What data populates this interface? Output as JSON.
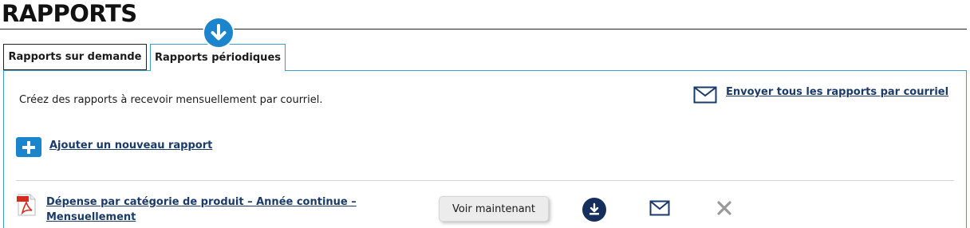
{
  "page": {
    "title": "RAPPORTS"
  },
  "tabs": [
    {
      "label": "Rapports sur demande",
      "active": false
    },
    {
      "label": "Rapports périodiques",
      "active": true
    }
  ],
  "panel": {
    "intro_text": "Créez des rapports à recevoir mensuellement par courriel.",
    "send_all_label": "Envoyer tous les rapports par courriel",
    "add_report_label": "Ajouter un nouveau rapport"
  },
  "reports": [
    {
      "name": "Dépense par catégorie de produit – Année continue – Mensuellement",
      "file_icon": "pdf-icon",
      "view_label": "Voir maintenant",
      "actions": [
        "download-icon",
        "mail-icon",
        "delete-icon"
      ]
    }
  ],
  "colors": {
    "accent": "#1a84cc",
    "tab_border": "#39a0c8",
    "link": "#1a3a68",
    "download_bg": "#142f5c",
    "delete": "#9a9a9a"
  }
}
